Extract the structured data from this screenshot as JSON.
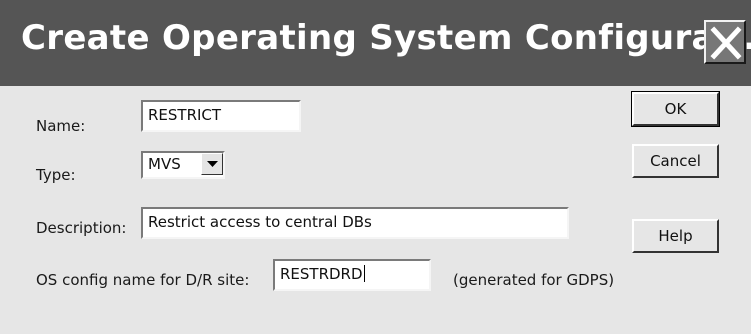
{
  "window": {
    "title": "Create Operating System Configurati...",
    "close_icon": "close-icon"
  },
  "form": {
    "name_label": "Name:",
    "name_value": "RESTRICT",
    "type_label": "Type:",
    "type_value": "MVS",
    "description_label": "Description:",
    "description_value": "Restrict access to central DBs",
    "dr_label": "OS config name for D/R site:",
    "dr_value": "RESTRDRD",
    "dr_note": "(generated for GDPS)"
  },
  "buttons": {
    "ok": "OK",
    "cancel": "Cancel",
    "help": "Help"
  },
  "colors": {
    "titlebar": "#555555",
    "dialog_bg": "#e6e6e6"
  }
}
